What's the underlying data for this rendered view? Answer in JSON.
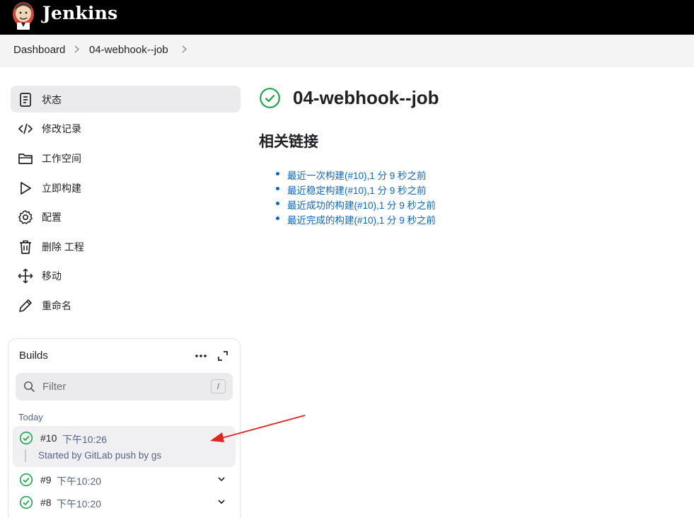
{
  "header": {
    "app_name": "Jenkins",
    "logo_icon": "jenkins-butler-logo"
  },
  "breadcrumb": {
    "items": [
      "Dashboard",
      "04-webhook--job"
    ],
    "separator": ">"
  },
  "sidebar": {
    "items": [
      {
        "label": "状态",
        "icon": "status-notepad-icon",
        "active": true
      },
      {
        "label": "修改记录",
        "icon": "code-icon"
      },
      {
        "label": "工作空间",
        "icon": "folder-icon"
      },
      {
        "label": "立即构建",
        "icon": "play-icon"
      },
      {
        "label": "配置",
        "icon": "gear-icon"
      },
      {
        "label": "删除 工程",
        "icon": "trash-icon"
      },
      {
        "label": "移动",
        "icon": "move-icon"
      },
      {
        "label": "重命名",
        "icon": "pencil-icon"
      }
    ]
  },
  "builds": {
    "title": "Builds",
    "filter_placeholder": "Filter",
    "filter_shortcut": "/",
    "group_label": "Today",
    "rows": [
      {
        "number": "#10",
        "time": "下午10:26",
        "description": "Started by GitLab push by gs",
        "status": "success"
      },
      {
        "number": "#9",
        "time": "下午10:20",
        "status": "success"
      },
      {
        "number": "#8",
        "time": "下午10:20",
        "status": "success"
      }
    ]
  },
  "main": {
    "job_title": "04-webhook--job",
    "job_status": "success",
    "related_title": "相关链接",
    "links": [
      "最近一次构建(#10),1 分 9 秒之前",
      "最近稳定构建(#10),1 分 9 秒之前",
      "最近成功的构建(#10),1 分 9 秒之前",
      "最近完成的构建(#10),1 分 9 秒之前"
    ]
  },
  "colors": {
    "success": "#1ea64b",
    "link": "#0b66c8",
    "annotation_arrow": "#e0241f",
    "header_bg": "#000000"
  }
}
